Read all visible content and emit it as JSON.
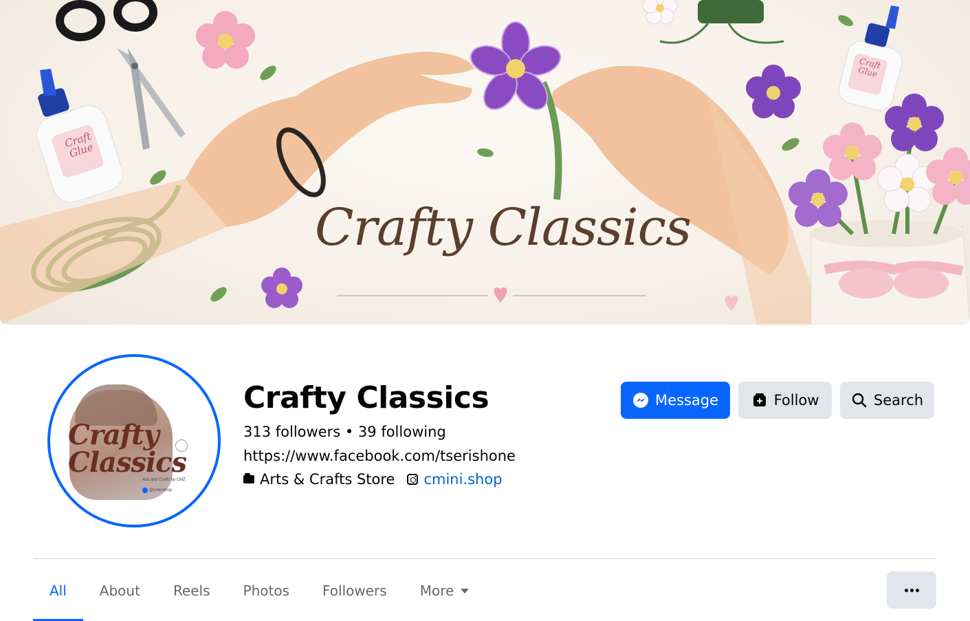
{
  "cover": {
    "title": "Crafty Classics",
    "glue_label_left": "Craft Glue",
    "glue_label_right": "Craft Glue"
  },
  "avatar": {
    "line1": "Crafty",
    "line2": "Classics",
    "subtitle": "Arts and Crafts by CMZ",
    "handle": "@cminishop"
  },
  "profile": {
    "name": "Crafty Classics",
    "followers_line": "313 followers • 39 following",
    "url": "https://www.facebook.com/tserishone",
    "category": "Arts & Crafts Store",
    "instagram": "cmini.shop"
  },
  "actions": {
    "message": "Message",
    "follow": "Follow",
    "search": "Search"
  },
  "tabs": [
    {
      "label": "All",
      "active": true
    },
    {
      "label": "About"
    },
    {
      "label": "Reels"
    },
    {
      "label": "Photos"
    },
    {
      "label": "Followers"
    },
    {
      "label": "More"
    }
  ],
  "colors": {
    "accent": "#0866ff",
    "link": "#0064d1",
    "secondary_button": "#e2e5e9",
    "muted_text": "#65686c"
  },
  "icons": {
    "message": "messenger-icon",
    "follow": "follow-icon",
    "search": "search-icon",
    "category": "category-icon",
    "instagram": "instagram-icon",
    "more": "caret-down-icon",
    "options": "more-options-icon"
  }
}
